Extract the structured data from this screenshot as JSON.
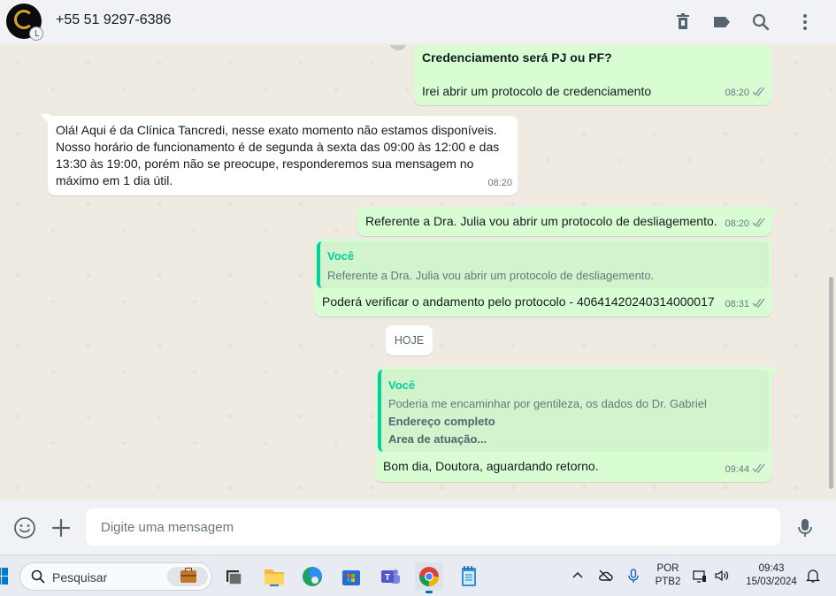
{
  "header": {
    "contact_name": "+55 51 9297-6386",
    "icons": [
      "delete-icon",
      "label-icon",
      "search-icon",
      "menu-icon"
    ]
  },
  "messages": [
    {
      "direction": "outgoing",
      "lines": [
        "Credenciamento será PJ ou PF?",
        "",
        "Irei abrir um protocolo de credenciamento"
      ],
      "time": "08:20",
      "status": "read"
    },
    {
      "direction": "incoming",
      "lines": [
        "Olá! Aqui é da Clínica Tancredi, nesse exato momento não estamos disponíveis.",
        "Nosso horário de funcionamento é de segunda à sexta das 09:00 às 12:00 e das",
        "13:30 às 19:00, porém não se preocupe, responderemos sua mensagem no",
        "máximo em 1 dia útil."
      ],
      "time": "08:20"
    },
    {
      "direction": "outgoing",
      "text": "Referente a Dra. Julia vou abrir um protocolo de desliagemento.",
      "time": "08:20",
      "status": "read"
    },
    {
      "direction": "outgoing",
      "quote": {
        "author": "Você",
        "lines": [
          "Referente a Dra. Julia vou abrir um protocolo de desliagemento."
        ]
      },
      "text": "Poderá verificar o andamento pelo protocolo - 40641420240314000017",
      "time": "08:31",
      "status": "read"
    },
    {
      "type": "date-divider",
      "label": "HOJE"
    },
    {
      "direction": "outgoing",
      "quote": {
        "author": "Você",
        "lines": [
          "Poderia me encaminhar por gentileza, os dados do Dr. Gabriel",
          "Endereço completo",
          "Area de atuação..."
        ]
      },
      "text": "Bom dia, Doutora, aguardando retorno.",
      "time": "09:44",
      "status": "read"
    }
  ],
  "composer": {
    "placeholder": "Digite uma mensagem",
    "icons": [
      "emoji-icon",
      "attach-plus-icon",
      "microphone-icon"
    ]
  },
  "taskbar": {
    "search_placeholder": "Pesquisar",
    "apps": [
      "task-view",
      "file-explorer",
      "edge",
      "microsoft-store",
      "teams",
      "chrome",
      "notepad"
    ],
    "language_top": "POR",
    "language_bottom": "PTB2",
    "time": "09:43",
    "date": "15/03/2024"
  },
  "colors": {
    "outgoing_bubble": "#d9fdd3",
    "incoming_bubble": "#ffffff",
    "chat_background": "#efeae2",
    "quote_accent": "#06cf9c",
    "read_ticks": "#53bdeb"
  }
}
